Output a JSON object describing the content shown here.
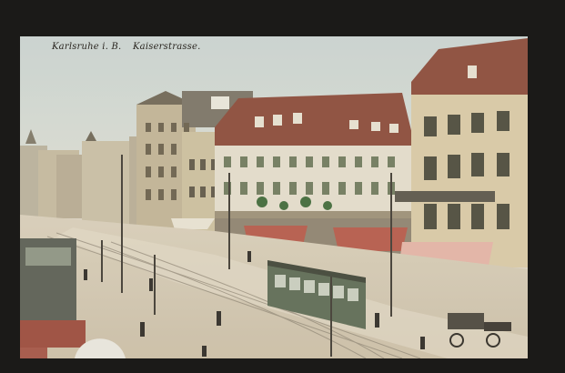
{
  "postcard": {
    "caption_city": "Karlsruhe i. B.",
    "caption_street": "Kaiserstrasse.",
    "sign_text": "",
    "colors": {
      "sky": "#cfd8d6",
      "building_tan": "#d8c9a7",
      "roof_red": "#8a4a3a",
      "awning_red": "#b55a4a",
      "tram_green": "#5d6b55",
      "street": "#cfc6b3"
    }
  }
}
